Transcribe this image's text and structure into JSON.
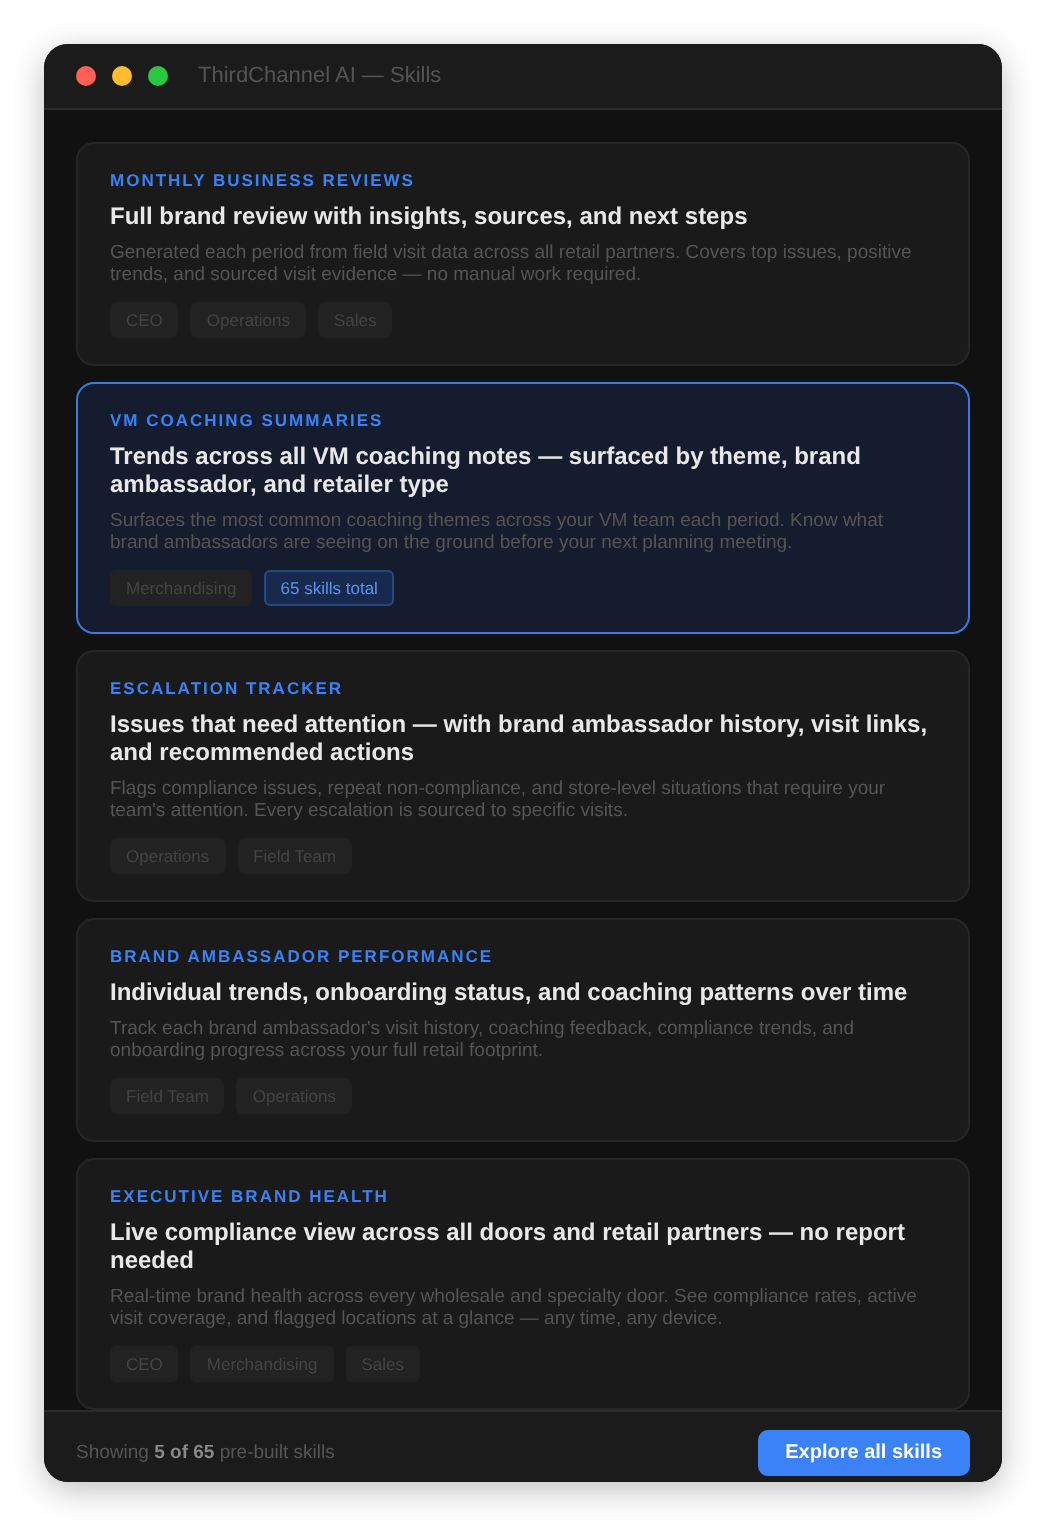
{
  "window": {
    "title": "ThirdChannel AI — Skills"
  },
  "skills": [
    {
      "category": "MONTHLY BUSINESS REVIEWS",
      "title": "Full brand review with insights, sources, and next steps",
      "description": "Generated each period from field visit data across all retail partners. Covers top issues, positive trends, and sourced visit evidence — no manual work required.",
      "selected": false,
      "tags": [
        {
          "label": "CEO",
          "kind": "tag"
        },
        {
          "label": "Operations",
          "kind": "tag"
        },
        {
          "label": "Sales",
          "kind": "tag"
        }
      ]
    },
    {
      "category": "VM COACHING SUMMARIES",
      "title": "Trends across all VM coaching notes — surfaced by theme, brand ambassador, and retailer type",
      "description": "Surfaces the most common coaching themes across your VM team each period. Know what brand ambassadors are seeing on the ground before your next planning meeting.",
      "selected": true,
      "tags": [
        {
          "label": "Merchandising",
          "kind": "tag"
        },
        {
          "label": "65 skills total",
          "kind": "count"
        }
      ]
    },
    {
      "category": "ESCALATION TRACKER",
      "title": "Issues that need attention — with brand ambassador history, visit links, and recommended actions",
      "description": "Flags compliance issues, repeat non-compliance, and store-level situations that require your team's attention. Every escalation is sourced to specific visits.",
      "selected": false,
      "tags": [
        {
          "label": "Operations",
          "kind": "tag"
        },
        {
          "label": "Field Team",
          "kind": "tag"
        }
      ]
    },
    {
      "category": "BRAND AMBASSADOR PERFORMANCE",
      "title": "Individual trends, onboarding status, and coaching patterns over time",
      "description": "Track each brand ambassador's visit history, coaching feedback, compliance trends, and onboarding progress across your full retail footprint.",
      "selected": false,
      "tags": [
        {
          "label": "Field Team",
          "kind": "tag"
        },
        {
          "label": "Operations",
          "kind": "tag"
        }
      ]
    },
    {
      "category": "EXECUTIVE BRAND HEALTH",
      "title": "Live compliance view across all doors and retail partners — no report needed",
      "description": "Real-time brand health across every wholesale and specialty door. See compliance rates, active visit coverage, and flagged locations at a glance — any time, any device.",
      "selected": false,
      "tags": [
        {
          "label": "CEO",
          "kind": "tag"
        },
        {
          "label": "Merchandising",
          "kind": "tag"
        },
        {
          "label": "Sales",
          "kind": "tag"
        }
      ]
    }
  ],
  "footer": {
    "summary": "Showing **5 of 65** pre-built skills",
    "button": "Explore all skills"
  }
}
